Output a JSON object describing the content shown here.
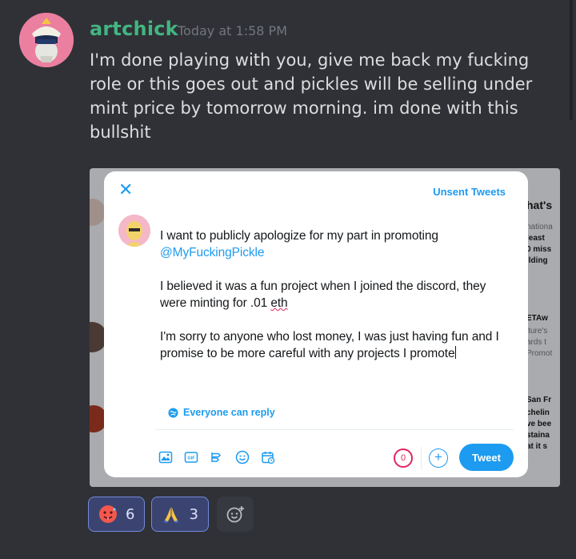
{
  "message": {
    "username": "artchick",
    "timestamp": "Today at 1:58 PM",
    "content": "I'm done playing with you, give me back my fucking role or this goes out and pickles will be selling under mint price by tomorrow morning.  im done with this bullshit"
  },
  "attachment": {
    "background_fragments": [
      {
        "text": "hat's",
        "style": "bold"
      },
      {
        "text": "nationa",
        "style": "light"
      },
      {
        "text": "least",
        "style": "bold"
      },
      {
        "text": "0 miss",
        "style": "bold"
      },
      {
        "text": "ilding",
        "style": "bold"
      },
      {
        "text": "ETAw",
        "style": "bold"
      },
      {
        "text": "lture's",
        "style": "light"
      },
      {
        "text": "ards t",
        "style": "light"
      },
      {
        "text": "Promot",
        "style": "light"
      },
      {
        "text": "San Fr",
        "style": "bold"
      },
      {
        "text": "chelin",
        "style": "bold"
      },
      {
        "text": "ve bee",
        "style": "bold"
      },
      {
        "text": "staina",
        "style": "bold"
      },
      {
        "text": "at it s",
        "style": "bold"
      }
    ],
    "compose": {
      "close_icon": "close-icon",
      "unsent_label": "Unsent Tweets",
      "line1": "I want to publicly apologize for my part in promoting",
      "mention": "@MyFuckingPickle",
      "para2_a": "I believed it was a fun project when I joined the discord, they were minting for .01 ",
      "para2_spell": "eth",
      "para3": "I'm sorry to anyone who lost money, I was just having fun and I promise to be more careful with any projects I promote",
      "reply_setting": "Everyone can reply",
      "toolbar_icons": [
        "image-icon",
        "gif-icon",
        "poll-icon",
        "emoji-icon",
        "schedule-icon"
      ],
      "char_count": "0",
      "add_label": "+",
      "tweet_label": "Tweet",
      "accent": "#1d9bf0"
    }
  },
  "reactions": [
    {
      "icon": "hot-face-emoji-icon",
      "count": "6"
    },
    {
      "icon": "folded-hands-emoji-icon",
      "count": "3"
    }
  ],
  "add_reaction_icon": "add-reaction-icon",
  "colors": {
    "background": "#2f3136",
    "username": "#43b581",
    "reaction_bg": "#3b4471",
    "reaction_border": "#7289da"
  }
}
